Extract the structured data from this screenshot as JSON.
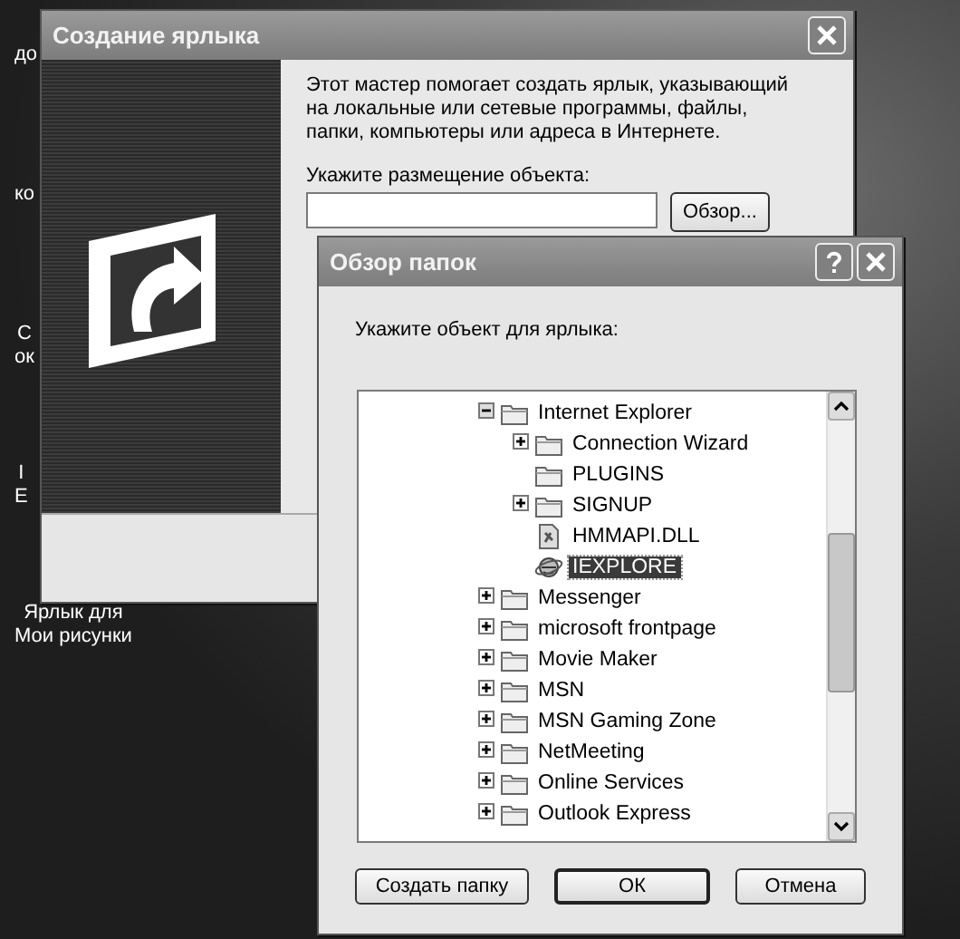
{
  "desktop_icons": [
    {
      "lines": [
        "до"
      ]
    },
    {
      "lines": [
        "ко"
      ]
    },
    {
      "lines": [
        "С",
        "ок"
      ]
    },
    {
      "lines": [
        "I",
        "E"
      ]
    },
    {
      "lines": [
        "Ярлык для",
        "Мои рисунки"
      ]
    }
  ],
  "wizard": {
    "title": "Создание ярлыка",
    "intro": "Этот мастер помогает создать ярлык, указывающий на локальные или сетевые программы, файлы, папки, компьютеры или адреса в Интернете.",
    "location_label": "Укажите размещение объекта:",
    "browse_button": "Обзор..."
  },
  "browse_dialog": {
    "title": "Обзор папок",
    "prompt": "Укажите объект для ярлыка:",
    "tree": [
      {
        "label": "Internet Explorer",
        "kind": "folder",
        "expanded": true,
        "selected": false,
        "children": [
          {
            "label": "Connection Wizard",
            "kind": "folder",
            "expanded": false,
            "selected": false
          },
          {
            "label": "PLUGINS",
            "kind": "empty-folder",
            "selected": false
          },
          {
            "label": "SIGNUP",
            "kind": "folder",
            "expanded": false,
            "selected": false
          },
          {
            "label": "HMMAPI.DLL",
            "kind": "file",
            "selected": false
          },
          {
            "label": "IEXPLORE",
            "kind": "program",
            "selected": true
          }
        ]
      },
      {
        "label": "Messenger",
        "kind": "folder",
        "expanded": false,
        "selected": false
      },
      {
        "label": "microsoft frontpage",
        "kind": "folder",
        "expanded": false,
        "selected": false
      },
      {
        "label": "Movie Maker",
        "kind": "folder",
        "expanded": false,
        "selected": false
      },
      {
        "label": "MSN",
        "kind": "folder",
        "expanded": false,
        "selected": false
      },
      {
        "label": "MSN Gaming Zone",
        "kind": "folder",
        "expanded": false,
        "selected": false
      },
      {
        "label": "NetMeeting",
        "kind": "folder",
        "expanded": false,
        "selected": false
      },
      {
        "label": "Online Services",
        "kind": "folder",
        "expanded": false,
        "selected": false
      },
      {
        "label": "Outlook Express",
        "kind": "folder",
        "expanded": false,
        "selected": false
      }
    ],
    "buttons": [
      {
        "label": "Создать папку",
        "kind": "new-folder"
      },
      {
        "label": "ОК",
        "kind": "default"
      },
      {
        "label": "Отмена",
        "kind": "cancel"
      }
    ]
  }
}
